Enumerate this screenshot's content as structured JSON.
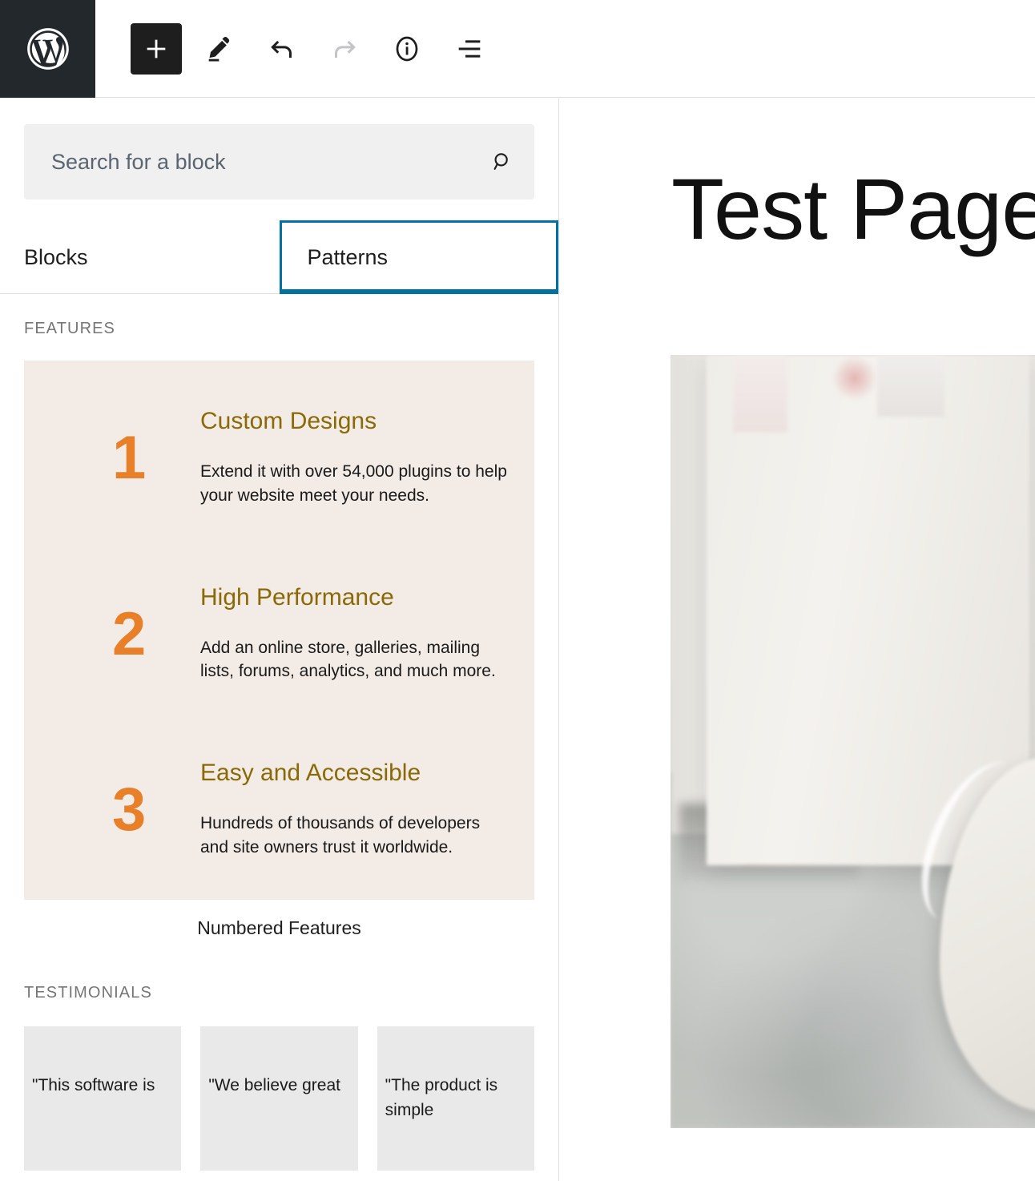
{
  "app": {
    "name": "WordPress Block Editor",
    "logo_icon": "wordpress-logo-icon"
  },
  "toolbar": {
    "buttons": [
      {
        "name": "add-block",
        "label": "Toggle block inserter",
        "icon": "plus-icon",
        "state": "active"
      },
      {
        "name": "edit-tool",
        "label": "Tools",
        "icon": "pencil-icon",
        "state": "enabled"
      },
      {
        "name": "undo",
        "label": "Undo",
        "icon": "undo-arrow-icon",
        "state": "enabled"
      },
      {
        "name": "redo",
        "label": "Redo",
        "icon": "redo-arrow-icon",
        "state": "disabled"
      },
      {
        "name": "details",
        "label": "Details",
        "icon": "info-circle-icon",
        "state": "enabled"
      },
      {
        "name": "list-view",
        "label": "List View",
        "icon": "list-view-icon",
        "state": "enabled"
      }
    ]
  },
  "inserter": {
    "search": {
      "placeholder": "Search for a block",
      "value": "",
      "icon": "search-icon"
    },
    "tabs": [
      {
        "label": "Blocks",
        "selected": false
      },
      {
        "label": "Patterns",
        "selected": true
      }
    ],
    "categories": [
      {
        "label": "FEATURES",
        "patterns": [
          {
            "title": "Numbered Features",
            "background_color": "#f2ebe6",
            "number_color": "#e8802a",
            "heading_color": "#8a6a06",
            "items": [
              {
                "number": "1",
                "title": "Custom Designs",
                "description": "Extend it with over 54,000 plugins to help your website meet your needs."
              },
              {
                "number": "2",
                "title": "High Performance",
                "description": "Add an online store, galleries, mailing lists, forums, analytics, and much more."
              },
              {
                "number": "3",
                "title": "Easy and Accessible",
                "description": "Hundreds of thousands of developers and site owners trust it worldwide."
              }
            ]
          }
        ]
      },
      {
        "label": "TESTIMONIALS",
        "cards": [
          {
            "quote": "\"This software is"
          },
          {
            "quote": "\"We believe great"
          },
          {
            "quote": "\"The product is simple"
          }
        ]
      }
    ]
  },
  "canvas": {
    "page_title": "Test Page",
    "image": {
      "name": "featured-photo",
      "alt": "Blurred photo of a white sneaker on a grey floor beside a pale panel"
    }
  },
  "colors": {
    "accent_blue": "#0071a1",
    "toolbar_dark": "#23282d",
    "button_dark": "#1e1e1e",
    "pattern_cream": "#f2ebe6",
    "orange": "#e8802a",
    "olive": "#8a6a06",
    "card_grey": "#e9e9e9"
  }
}
